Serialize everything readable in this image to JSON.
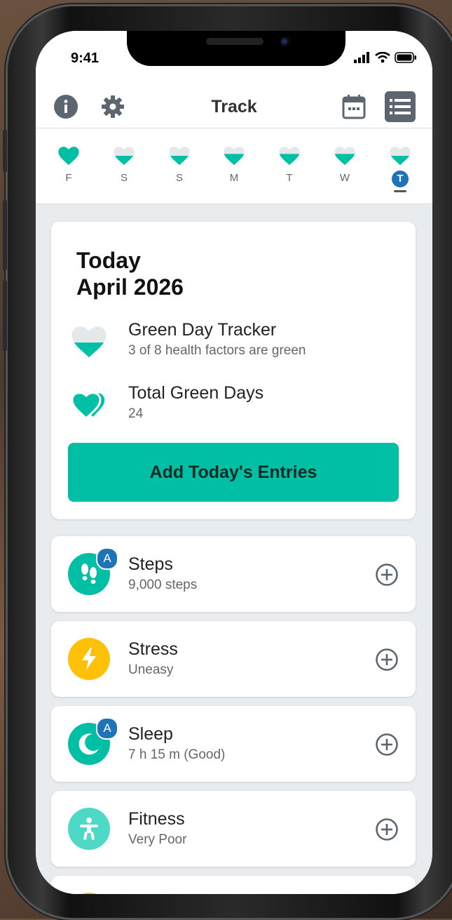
{
  "status_bar": {
    "time": "9:41"
  },
  "nav": {
    "title": "Track"
  },
  "week": {
    "days": [
      {
        "letter": "F",
        "fill": 1.0
      },
      {
        "letter": "S",
        "fill": 0.5
      },
      {
        "letter": "S",
        "fill": 0.5
      },
      {
        "letter": "M",
        "fill": 0.6
      },
      {
        "letter": "T",
        "fill": 0.6
      },
      {
        "letter": "W",
        "fill": 0.6
      },
      {
        "letter": "T",
        "fill": 0.5,
        "today": true
      }
    ]
  },
  "summary": {
    "title": "Today\nApril 2026",
    "tracker_title": "Green Day Tracker",
    "tracker_sub": "3 of 8 health factors are green",
    "tracker_fill": 0.375,
    "total_title": "Total Green Days",
    "total_value": "24",
    "cta_label": "Add Today's Entries"
  },
  "metrics": [
    {
      "title": "Steps",
      "value": "9,000 steps",
      "icon": "footprints-icon",
      "color": "#00bfa5",
      "auto": true
    },
    {
      "title": "Stress",
      "value": "Uneasy",
      "icon": "lightning-icon",
      "color": "#ffc107",
      "auto": false
    },
    {
      "title": "Sleep",
      "value": "7 h 15 m (Good)",
      "icon": "moon-icon",
      "color": "#00bfa5",
      "auto": true
    },
    {
      "title": "Fitness",
      "value": "Very Poor",
      "icon": "person-icon",
      "color": "#4dd9c5",
      "auto": false
    }
  ],
  "badge_letter": "A",
  "colors": {
    "accent": "#00bfa5",
    "badge_blue": "#1f73b7",
    "stress_yellow": "#ffc107"
  }
}
